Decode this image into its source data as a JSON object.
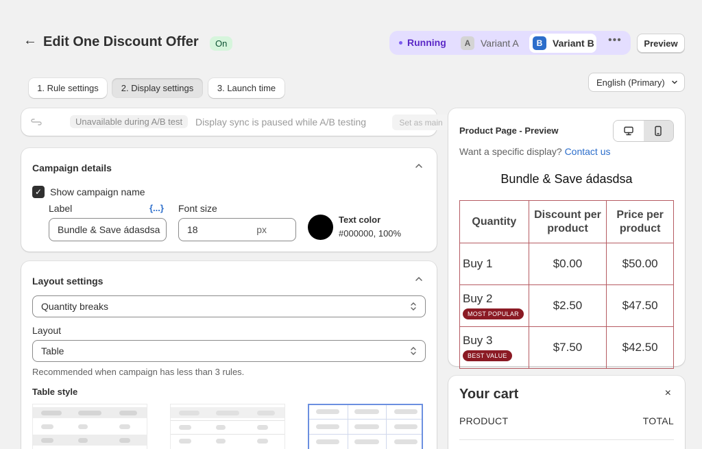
{
  "header": {
    "title": "Edit One Discount Offer",
    "status_badge": "On",
    "running_label": "Running",
    "variant_a_letter": "A",
    "variant_a_label": "Variant A",
    "variant_b_letter": "B",
    "variant_b_label": "Variant B",
    "more_label": "•••",
    "preview_label": "Preview"
  },
  "tabs": [
    {
      "label": "1. Rule settings",
      "active": false
    },
    {
      "label": "2. Display settings",
      "active": true
    },
    {
      "label": "3. Launch time",
      "active": false
    }
  ],
  "language_select": {
    "value": "English (Primary)"
  },
  "sync_bar": {
    "badge": "Unavailable during A/B test",
    "message": "Display sync is paused while A/B testing",
    "set_main_label": "Set as main"
  },
  "campaign_details": {
    "title": "Campaign details",
    "show_name_label": "Show campaign name",
    "show_name_checked": true,
    "label_field_label": "Label",
    "variable_link": "{...}",
    "label_value": "Bundle & Save ádasdsa",
    "font_size_label": "Font size",
    "font_size_value": "18",
    "font_size_suffix": "px",
    "text_color_label": "Text color",
    "text_color_value": "#000000, 100%",
    "text_color_hex": "#000000"
  },
  "layout_settings": {
    "title": "Layout settings",
    "type_value": "Quantity breaks",
    "layout_label": "Layout",
    "layout_value": "Table",
    "help_text": "Recommended when campaign has less than 3 rules.",
    "table_style_label": "Table style",
    "selected_style_index": 2
  },
  "preview": {
    "title": "Product Page - Preview",
    "want_text": "Want a specific display?",
    "contact_link": "Contact us",
    "bundle_title": "Bundle & Save ádasdsa",
    "headers": [
      "Quantity",
      "Discount per product",
      "Price per product"
    ],
    "rows": [
      {
        "qty": "Buy 1",
        "tag": "",
        "discount": "$0.00",
        "price": "$50.00"
      },
      {
        "qty": "Buy 2",
        "tag": "MOST POPULAR",
        "discount": "$2.50",
        "price": "$47.50"
      },
      {
        "qty": "Buy 3",
        "tag": "BEST VALUE",
        "discount": "$7.50",
        "price": "$42.50"
      }
    ],
    "device_active": "mobile"
  },
  "cart": {
    "title": "Your cart",
    "close_label": "×",
    "col_product": "PRODUCT",
    "col_total": "TOTAL"
  }
}
